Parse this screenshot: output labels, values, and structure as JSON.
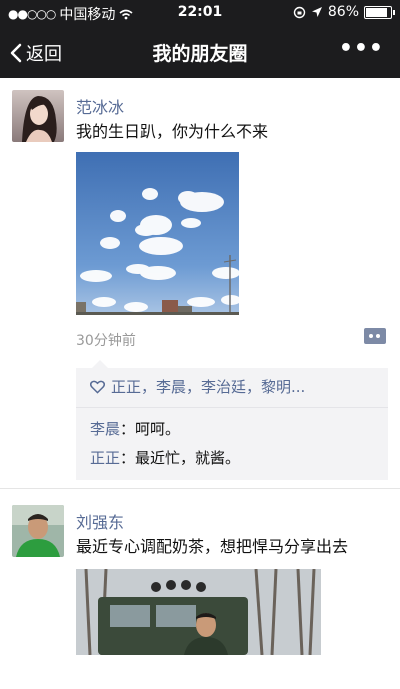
{
  "status": {
    "carrier": "中国移动",
    "time": "22:01",
    "battery": "86%",
    "battery_level": 0.86
  },
  "nav": {
    "back": "返回",
    "title": "我的朋友圈",
    "more": "•••"
  },
  "posts": [
    {
      "name": "范冰冰",
      "text": "我的生日趴，你为什么不来",
      "time": "30分钟前",
      "likes": "正正，李晨，李治廷，黎明...",
      "comments": [
        {
          "name": "李晨",
          "sep": "：",
          "text": "呵呵。"
        },
        {
          "name": "正正",
          "sep": "：",
          "text": "最近忙，就酱。"
        }
      ]
    },
    {
      "name": "刘强东",
      "text": "最近专心调配奶茶，想把悍马分享出去"
    }
  ],
  "colors": {
    "link": "#576b95",
    "bar": "#1c1c1e",
    "time": "#9a9a9a"
  }
}
